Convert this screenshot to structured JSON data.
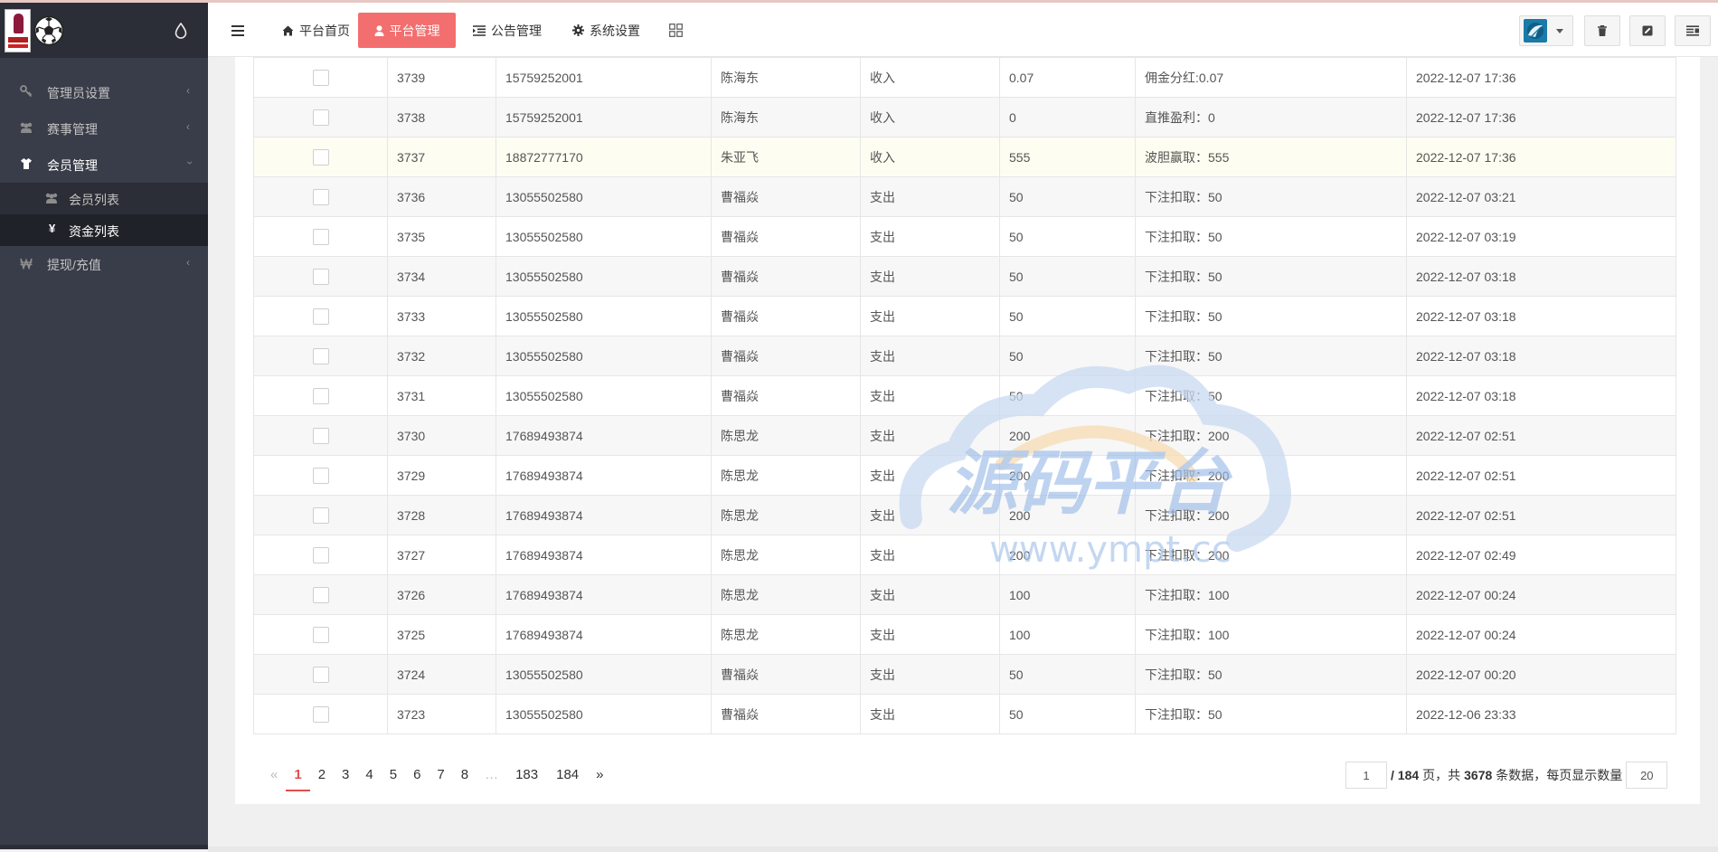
{
  "sidebar": {
    "menu": [
      {
        "label": "管理员设置",
        "icon": "key-icon"
      },
      {
        "label": "赛事管理",
        "icon": "users-icon"
      },
      {
        "label": "会员管理",
        "icon": "tshirt-icon"
      },
      {
        "label": "提现/充值",
        "icon": "won-icon"
      }
    ],
    "submenu": [
      {
        "label": "会员列表",
        "icon": "users-icon"
      },
      {
        "label": "资金列表",
        "icon": "yen-icon",
        "glyph": "¥"
      }
    ]
  },
  "header": {
    "nav": [
      {
        "label": "平台首页",
        "icon": "home-icon"
      },
      {
        "label": "平台管理",
        "icon": "user-icon"
      },
      {
        "label": "公告管理",
        "icon": "indent-icon"
      },
      {
        "label": "系统设置",
        "icon": "gear-icon"
      }
    ],
    "grid_icon": "grid-icon",
    "right_buttons": [
      "avatar",
      "trash-icon",
      "edit-icon",
      "list-settings-icon"
    ]
  },
  "table": {
    "rows": [
      {
        "id": "3739",
        "phone": "15759252001",
        "name": "陈海东",
        "type": "收入",
        "amount": "0.07",
        "note": "佣金分红:0.07",
        "time": "2022-12-07 17:36"
      },
      {
        "id": "3738",
        "phone": "15759252001",
        "name": "陈海东",
        "type": "收入",
        "amount": "0",
        "note": "直推盈利：0",
        "time": "2022-12-07 17:36"
      },
      {
        "id": "3737",
        "phone": "18872777170",
        "name": "朱亚飞",
        "type": "收入",
        "amount": "555",
        "note": "波胆赢取：555",
        "time": "2022-12-07 17:36"
      },
      {
        "id": "3736",
        "phone": "13055502580",
        "name": "曹福焱",
        "type": "支出",
        "amount": "50",
        "note": "下注扣取：50",
        "time": "2022-12-07 03:21"
      },
      {
        "id": "3735",
        "phone": "13055502580",
        "name": "曹福焱",
        "type": "支出",
        "amount": "50",
        "note": "下注扣取：50",
        "time": "2022-12-07 03:19"
      },
      {
        "id": "3734",
        "phone": "13055502580",
        "name": "曹福焱",
        "type": "支出",
        "amount": "50",
        "note": "下注扣取：50",
        "time": "2022-12-07 03:18"
      },
      {
        "id": "3733",
        "phone": "13055502580",
        "name": "曹福焱",
        "type": "支出",
        "amount": "50",
        "note": "下注扣取：50",
        "time": "2022-12-07 03:18"
      },
      {
        "id": "3732",
        "phone": "13055502580",
        "name": "曹福焱",
        "type": "支出",
        "amount": "50",
        "note": "下注扣取：50",
        "time": "2022-12-07 03:18"
      },
      {
        "id": "3731",
        "phone": "13055502580",
        "name": "曹福焱",
        "type": "支出",
        "amount": "50",
        "note": "下注扣取：50",
        "time": "2022-12-07 03:18"
      },
      {
        "id": "3730",
        "phone": "17689493874",
        "name": "陈思龙",
        "type": "支出",
        "amount": "200",
        "note": "下注扣取：200",
        "time": "2022-12-07 02:51"
      },
      {
        "id": "3729",
        "phone": "17689493874",
        "name": "陈思龙",
        "type": "支出",
        "amount": "200",
        "note": "下注扣取：200",
        "time": "2022-12-07 02:51"
      },
      {
        "id": "3728",
        "phone": "17689493874",
        "name": "陈思龙",
        "type": "支出",
        "amount": "200",
        "note": "下注扣取：200",
        "time": "2022-12-07 02:51"
      },
      {
        "id": "3727",
        "phone": "17689493874",
        "name": "陈思龙",
        "type": "支出",
        "amount": "200",
        "note": "下注扣取：200",
        "time": "2022-12-07 02:49"
      },
      {
        "id": "3726",
        "phone": "17689493874",
        "name": "陈思龙",
        "type": "支出",
        "amount": "100",
        "note": "下注扣取：100",
        "time": "2022-12-07 00:24"
      },
      {
        "id": "3725",
        "phone": "17689493874",
        "name": "陈思龙",
        "type": "支出",
        "amount": "100",
        "note": "下注扣取：100",
        "time": "2022-12-07 00:24"
      },
      {
        "id": "3724",
        "phone": "13055502580",
        "name": "曹福焱",
        "type": "支出",
        "amount": "50",
        "note": "下注扣取：50",
        "time": "2022-12-07 00:20"
      },
      {
        "id": "3723",
        "phone": "13055502580",
        "name": "曹福焱",
        "type": "支出",
        "amount": "50",
        "note": "下注扣取：50",
        "time": "2022-12-06 23:33"
      }
    ]
  },
  "pagination": {
    "prev": "«",
    "pages": [
      "1",
      "2",
      "3",
      "4",
      "5",
      "6",
      "7",
      "8"
    ],
    "ellipsis": "…",
    "last_pages": [
      "183",
      "184"
    ],
    "next": "»",
    "current_page": "1",
    "total_pages_text": "/ 184",
    "page_suffix": "页，共",
    "total_records": "3678",
    "records_suffix": "条数据，每页显示数量",
    "page_size": "20"
  },
  "watermark": {
    "title": "源码平台",
    "url": "www.ympt.cc"
  }
}
